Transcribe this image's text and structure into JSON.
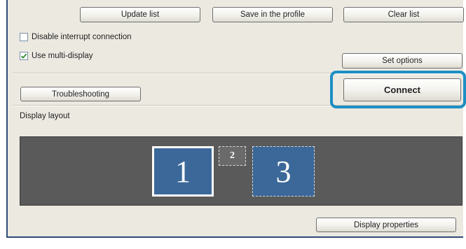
{
  "buttons": {
    "update_list": "Update list",
    "save_profile": "Save in the profile",
    "clear_list": "Clear list",
    "set_options": "Set options",
    "connect": "Connect",
    "troubleshooting": "Troubleshooting",
    "display_properties": "Display properties"
  },
  "options": {
    "disable_interrupt": {
      "label": "Disable interrupt connection",
      "checked": false
    },
    "multi_display": {
      "label": "Use multi-display",
      "checked": true
    }
  },
  "display_layout": {
    "label": "Display layout",
    "monitors": [
      {
        "number": "1",
        "selected": true
      },
      {
        "number": "2",
        "selected": false
      },
      {
        "number": "3",
        "selected": false
      }
    ]
  },
  "colors": {
    "window_bg": "#ece9e1",
    "layout_bg": "#5a5a5a",
    "monitor_fill": "#3b6899",
    "highlight": "#1d8fc4",
    "check_mark": "#2e8a2e"
  },
  "icons": {
    "checkbox_checked": "check-icon"
  }
}
